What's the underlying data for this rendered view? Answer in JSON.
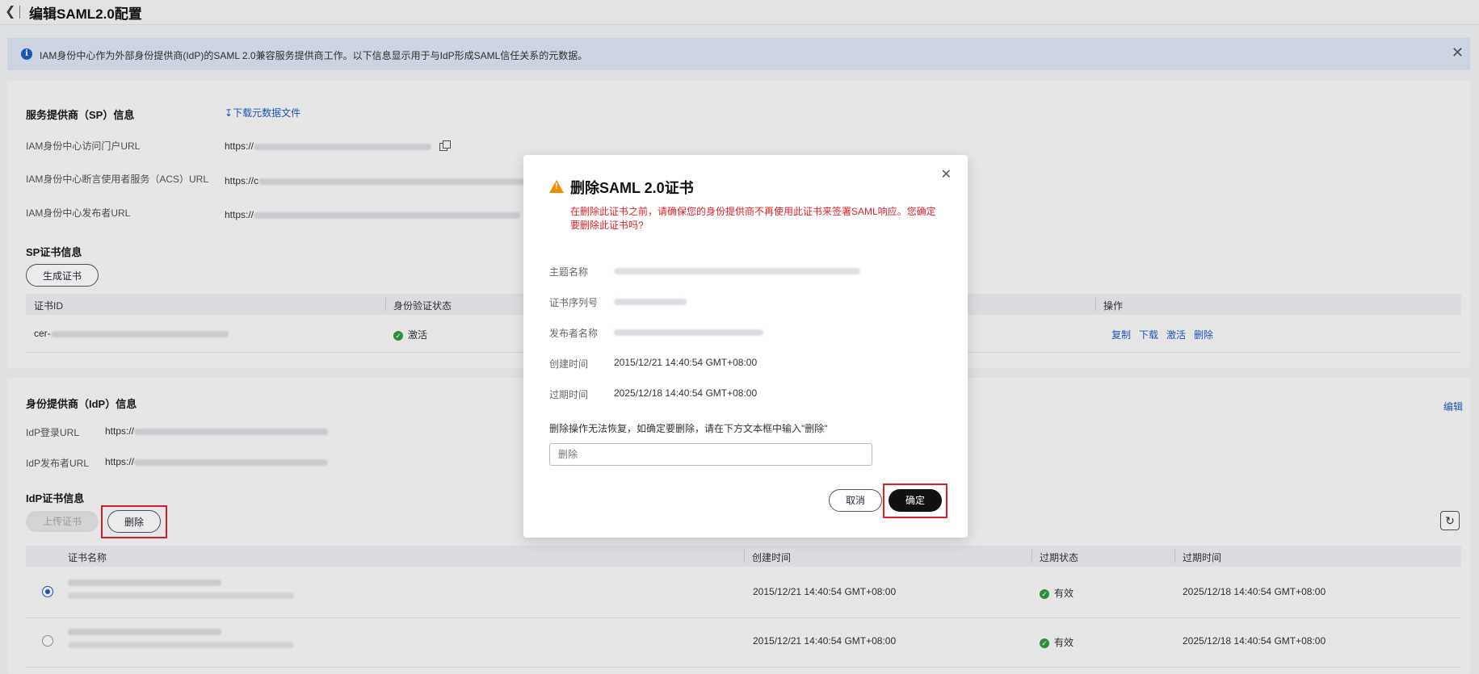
{
  "header": {
    "back_icon": "chevron-left-icon",
    "title": "编辑SAML2.0配置"
  },
  "info_bar": {
    "text": "IAM身份中心作为外部身份提供商(IdP)的SAML 2.0兼容服务提供商工作。以下信息显示用于与IdP形成SAML信任关系的元数据。",
    "icon": "info-icon",
    "close_icon": "close-icon"
  },
  "sp": {
    "title": "服务提供商（SP）信息",
    "download_label": "下载元数据文件",
    "fields": [
      {
        "label": "IAM身份中心访问门户URL",
        "value": "https://"
      },
      {
        "label": "IAM身份中心断言使用者服务（ACS）URL",
        "value": "https://c"
      },
      {
        "label": "IAM身份中心发布者URL",
        "value": "https://"
      }
    ],
    "cert_title": "SP证书信息",
    "generate_button": "生成证书",
    "table": {
      "headers": [
        "证书ID",
        "身份验证状态",
        "操作"
      ],
      "row": {
        "id_prefix": "cer-",
        "status": "激活",
        "actions": [
          "复制",
          "下载",
          "激活",
          "删除"
        ]
      }
    }
  },
  "idp": {
    "title": "身份提供商（IdP）信息",
    "edit_label": "编辑",
    "fields": [
      {
        "label": "IdP登录URL",
        "value": "https://"
      },
      {
        "label": "IdP发布者URL",
        "value": "https://"
      }
    ],
    "cert_title": "IdP证书信息",
    "upload_button": "上传证书",
    "delete_button": "删除",
    "table": {
      "headers": [
        "证书名称",
        "创建时间",
        "过期状态",
        "过期时间"
      ],
      "rows": [
        {
          "selected": true,
          "created": "2015/12/21 14:40:54 GMT+08:00",
          "status": "有效",
          "expires": "2025/12/18 14:40:54 GMT+08:00"
        },
        {
          "selected": false,
          "created": "2015/12/21 14:40:54 GMT+08:00",
          "status": "有效",
          "expires": "2025/12/18 14:40:54 GMT+08:00"
        }
      ]
    }
  },
  "modal": {
    "title": "删除SAML 2.0证书",
    "warning": "在删除此证书之前，请确保您的身份提供商不再使用此证书来签署SAML响应。您确定要删除此证书吗?",
    "fields": [
      {
        "label": "主题名称",
        "value": ""
      },
      {
        "label": "证书序列号",
        "value": ""
      },
      {
        "label": "发布者名称",
        "value": ""
      },
      {
        "label": "创建时间",
        "value": "2015/12/21 14:40:54 GMT+08:00"
      },
      {
        "label": "过期时间",
        "value": "2025/12/18 14:40:54 GMT+08:00"
      }
    ],
    "note": "删除操作无法恢复，如确定要删除，请在下方文本框中输入\"删除\"",
    "input_placeholder": "删除",
    "cancel_button": "取消",
    "confirm_button": "确定"
  }
}
